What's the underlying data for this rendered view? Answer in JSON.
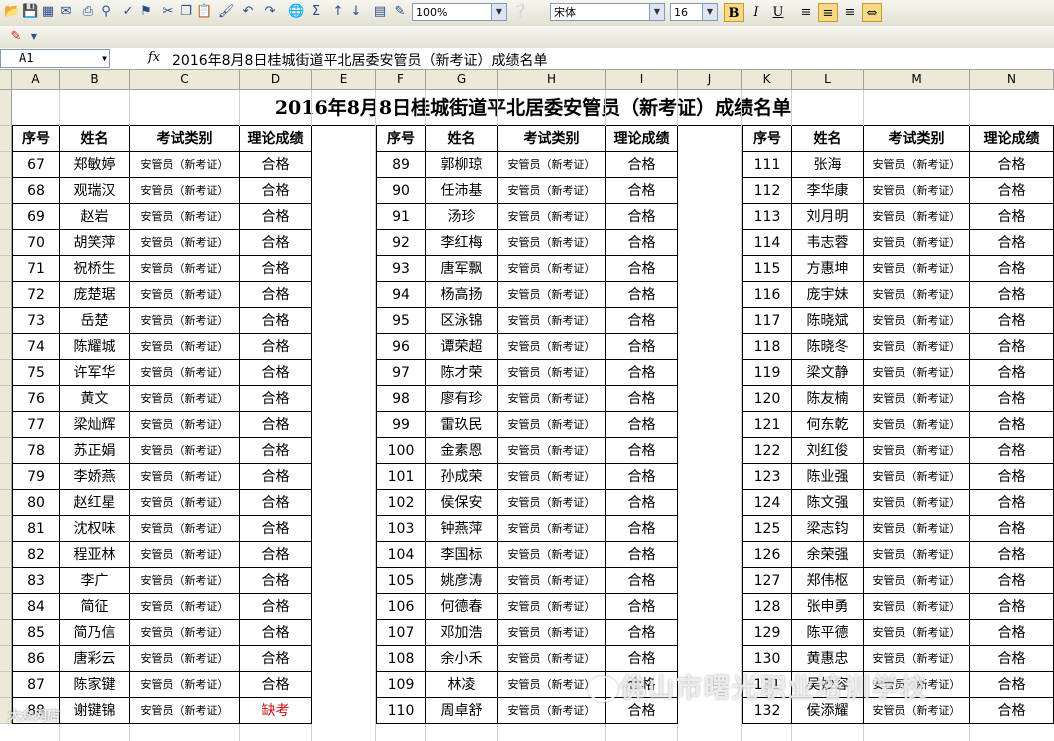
{
  "toolbar": {
    "zoom": "100%",
    "font_name": "宋体",
    "font_size": "16",
    "bold_label": "B",
    "italic_label": "I",
    "underline_label": "U"
  },
  "formula_bar": {
    "name_box": "A1",
    "fx_label": "fx",
    "content": "2016年8月8日桂城街道平北居委安管员（新考证）成绩名单"
  },
  "columns": [
    "A",
    "B",
    "C",
    "D",
    "E",
    "F",
    "G",
    "H",
    "I",
    "J",
    "K",
    "L",
    "M",
    "N"
  ],
  "sheet_title": "2016年8月8日桂城街道平北居委安管员（新考证）成绩名单",
  "headers": [
    "序号",
    "姓名",
    "考试类别",
    "理论成绩"
  ],
  "blocks": [
    {
      "rows": [
        [
          "67",
          "郑敏婷",
          "安管员（新考证）",
          "合格"
        ],
        [
          "68",
          "观瑞汉",
          "安管员（新考证）",
          "合格"
        ],
        [
          "69",
          "赵岩",
          "安管员（新考证）",
          "合格"
        ],
        [
          "70",
          "胡笑萍",
          "安管员（新考证）",
          "合格"
        ],
        [
          "71",
          "祝桥生",
          "安管员（新考证）",
          "合格"
        ],
        [
          "72",
          "庞楚琚",
          "安管员（新考证）",
          "合格"
        ],
        [
          "73",
          "岳楚",
          "安管员（新考证）",
          "合格"
        ],
        [
          "74",
          "陈耀城",
          "安管员（新考证）",
          "合格"
        ],
        [
          "75",
          "许军华",
          "安管员（新考证）",
          "合格"
        ],
        [
          "76",
          "黄文",
          "安管员（新考证）",
          "合格"
        ],
        [
          "77",
          "梁灿辉",
          "安管员（新考证）",
          "合格"
        ],
        [
          "78",
          "苏正娟",
          "安管员（新考证）",
          "合格"
        ],
        [
          "79",
          "李娇燕",
          "安管员（新考证）",
          "合格"
        ],
        [
          "80",
          "赵红星",
          "安管员（新考证）",
          "合格"
        ],
        [
          "81",
          "沈权味",
          "安管员（新考证）",
          "合格"
        ],
        [
          "82",
          "程亚林",
          "安管员（新考证）",
          "合格"
        ],
        [
          "83",
          "李广",
          "安管员（新考证）",
          "合格"
        ],
        [
          "84",
          "简征",
          "安管员（新考证）",
          "合格"
        ],
        [
          "85",
          "简乃信",
          "安管员（新考证）",
          "合格"
        ],
        [
          "86",
          "唐彩云",
          "安管员（新考证）",
          "合格"
        ],
        [
          "87",
          "陈家键",
          "安管员（新考证）",
          "合格"
        ],
        [
          "88",
          "谢键锦",
          "安管员（新考证）",
          "缺考"
        ]
      ]
    },
    {
      "rows": [
        [
          "89",
          "郭柳琼",
          "安管员（新考证）",
          "合格"
        ],
        [
          "90",
          "任沛基",
          "安管员（新考证）",
          "合格"
        ],
        [
          "91",
          "汤珍",
          "安管员（新考证）",
          "合格"
        ],
        [
          "92",
          "李红梅",
          "安管员（新考证）",
          "合格"
        ],
        [
          "93",
          "唐军飘",
          "安管员（新考证）",
          "合格"
        ],
        [
          "94",
          "杨高扬",
          "安管员（新考证）",
          "合格"
        ],
        [
          "95",
          "区泳锦",
          "安管员（新考证）",
          "合格"
        ],
        [
          "96",
          "谭荣超",
          "安管员（新考证）",
          "合格"
        ],
        [
          "97",
          "陈才荣",
          "安管员（新考证）",
          "合格"
        ],
        [
          "98",
          "廖有珍",
          "安管员（新考证）",
          "合格"
        ],
        [
          "99",
          "雷玖民",
          "安管员（新考证）",
          "合格"
        ],
        [
          "100",
          "金素恩",
          "安管员（新考证）",
          "合格"
        ],
        [
          "101",
          "孙成荣",
          "安管员（新考证）",
          "合格"
        ],
        [
          "102",
          "侯保安",
          "安管员（新考证）",
          "合格"
        ],
        [
          "103",
          "钟燕萍",
          "安管员（新考证）",
          "合格"
        ],
        [
          "104",
          "李国标",
          "安管员（新考证）",
          "合格"
        ],
        [
          "105",
          "姚彦涛",
          "安管员（新考证）",
          "合格"
        ],
        [
          "106",
          "何德春",
          "安管员（新考证）",
          "合格"
        ],
        [
          "107",
          "邓加浩",
          "安管员（新考证）",
          "合格"
        ],
        [
          "108",
          "余小禾",
          "安管员（新考证）",
          "合格"
        ],
        [
          "109",
          "林凌",
          "安管员（新考证）",
          "合格"
        ],
        [
          "110",
          "周卓舒",
          "安管员（新考证）",
          "合格"
        ]
      ]
    },
    {
      "rows": [
        [
          "111",
          "张海",
          "安管员（新考证）",
          "合格"
        ],
        [
          "112",
          "李华康",
          "安管员（新考证）",
          "合格"
        ],
        [
          "113",
          "刘月明",
          "安管员（新考证）",
          "合格"
        ],
        [
          "114",
          "韦志蓉",
          "安管员（新考证）",
          "合格"
        ],
        [
          "115",
          "方惠坤",
          "安管员（新考证）",
          "合格"
        ],
        [
          "116",
          "庞宇妹",
          "安管员（新考证）",
          "合格"
        ],
        [
          "117",
          "陈晓斌",
          "安管员（新考证）",
          "合格"
        ],
        [
          "118",
          "陈晓冬",
          "安管员（新考证）",
          "合格"
        ],
        [
          "119",
          "梁文静",
          "安管员（新考证）",
          "合格"
        ],
        [
          "120",
          "陈友楠",
          "安管员（新考证）",
          "合格"
        ],
        [
          "121",
          "何东乾",
          "安管员（新考证）",
          "合格"
        ],
        [
          "122",
          "刘红俊",
          "安管员（新考证）",
          "合格"
        ],
        [
          "123",
          "陈业强",
          "安管员（新考证）",
          "合格"
        ],
        [
          "124",
          "陈文强",
          "安管员（新考证）",
          "合格"
        ],
        [
          "125",
          "梁志钧",
          "安管员（新考证）",
          "合格"
        ],
        [
          "126",
          "余荣强",
          "安管员（新考证）",
          "合格"
        ],
        [
          "127",
          "郑伟枢",
          "安管员（新考证）",
          "合格"
        ],
        [
          "128",
          "张申勇",
          "安管员（新考证）",
          "合格"
        ],
        [
          "129",
          "陈平德",
          "安管员（新考证）",
          "合格"
        ],
        [
          "130",
          "黄惠忠",
          "安管员（新考证）",
          "合格"
        ],
        [
          "131",
          "吴妙容",
          "安管员（新考证）",
          "合格"
        ],
        [
          "132",
          "侯添耀",
          "安管员（新考证）",
          "合格"
        ]
      ]
    }
  ],
  "watermark": "佛山市曙光职业培训学校",
  "watermark_corner": "大众网店",
  "status_colors": {
    "absent": "#cc1010"
  }
}
